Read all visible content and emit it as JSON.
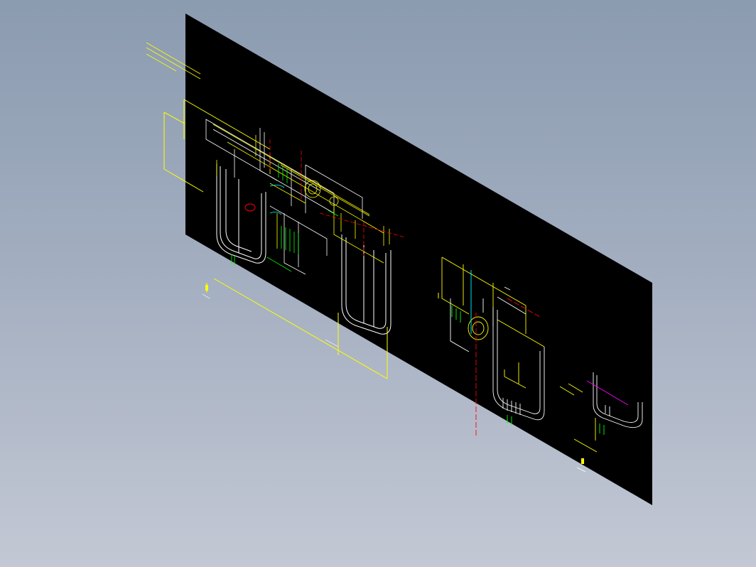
{
  "viewer": {
    "background_top": "#8b9bb0",
    "background_bottom": "#c3c8d4"
  },
  "sheet": {
    "fill": "#000000",
    "line_colors": {
      "yellow": "#ffff00",
      "white": "#ffffff",
      "green": "#00ff00",
      "red": "#ff0000",
      "cyan": "#00ffff",
      "magenta": "#ff00ff"
    }
  }
}
